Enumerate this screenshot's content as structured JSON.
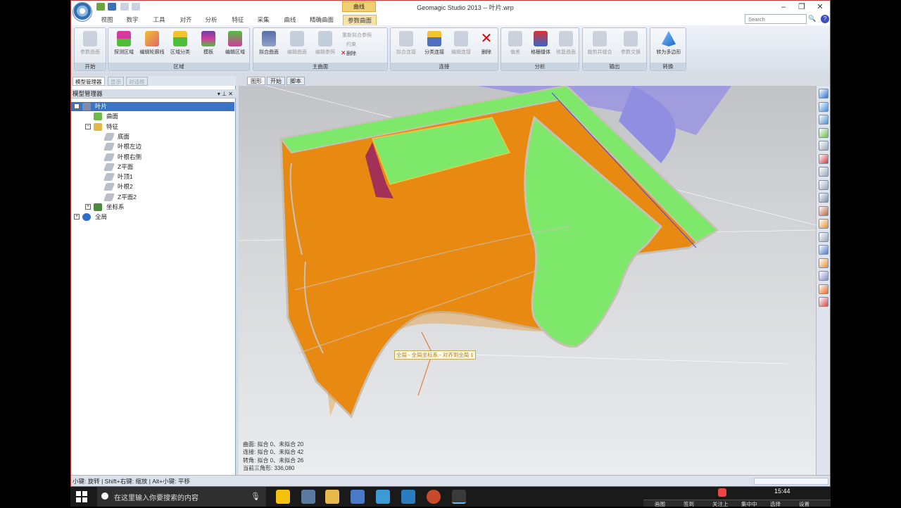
{
  "window": {
    "title": "Geomagic Studio 2013 -- 叶片.wrp",
    "context_tab": "曲线"
  },
  "menu_tabs": [
    "视图",
    "数字",
    "工具",
    "对齐",
    "分析",
    "特征",
    "采集",
    "曲线",
    "精确曲面",
    "参数曲面"
  ],
  "active_tab": "参数曲面",
  "search_placeholder": "Search",
  "ribbon": {
    "groups": [
      {
        "name": "开始",
        "buttons": [
          "参数曲面"
        ]
      },
      {
        "name": "区域",
        "buttons": [
          "探测区域",
          "编辑轮廓线",
          "区域分类",
          "模板",
          "编辑区域"
        ]
      },
      {
        "name": "主曲面",
        "buttons": [
          "拟合曲面",
          "编辑曲面",
          "编辑参照"
        ],
        "small": [
          "重新拟合参照",
          "约束",
          "删除"
        ]
      },
      {
        "name": "连接",
        "buttons": [
          "拟合连接",
          "分类连接",
          "编辑连接",
          "删除"
        ]
      },
      {
        "name": "分析",
        "buttons": [
          "偏差",
          "格栅缝体",
          "修复曲面"
        ]
      },
      {
        "name": "输出",
        "buttons": [
          "裁剪并缝合",
          "参数交换"
        ]
      },
      {
        "name": "转换",
        "buttons": [
          "转为多边形"
        ]
      }
    ]
  },
  "panel": {
    "tabs": [
      "模型管理器",
      "显示",
      "对话框"
    ],
    "title": "模型管理器",
    "pin": "▾ ⊥ ✕",
    "tree": [
      {
        "label": "叶片",
        "level": 0,
        "exp": "−",
        "selected": true,
        "icon": "part-icon"
      },
      {
        "label": "曲面",
        "level": 1,
        "exp": "",
        "icon": "surface-icon"
      },
      {
        "label": "特征",
        "level": 1,
        "exp": "−",
        "icon": "feature-icon"
      },
      {
        "label": "底面",
        "level": 2,
        "exp": "",
        "icon": "plane-icon"
      },
      {
        "label": "叶根左边",
        "level": 2,
        "exp": "",
        "icon": "plane-icon"
      },
      {
        "label": "叶根右侧",
        "level": 2,
        "exp": "",
        "icon": "plane-icon"
      },
      {
        "label": "Z平面",
        "level": 2,
        "exp": "",
        "icon": "plane-icon"
      },
      {
        "label": "叶顶1",
        "level": 2,
        "exp": "",
        "icon": "plane-icon"
      },
      {
        "label": "叶根2",
        "level": 2,
        "exp": "",
        "icon": "plane-icon"
      },
      {
        "label": "Z平面2",
        "level": 2,
        "exp": "",
        "icon": "plane-icon"
      },
      {
        "label": "坐标系",
        "level": 1,
        "exp": "+",
        "icon": "axis-icon"
      },
      {
        "label": "全局",
        "level": 0,
        "exp": "+",
        "icon": "globe-icon"
      }
    ]
  },
  "view_tabs": [
    "图形",
    "开始",
    "脚本"
  ],
  "viewport": {
    "label": "全局 - 全局坐标系 - 对齐到全局 1",
    "stats": [
      "曲面: 拟合 0、未拟合 20",
      "连接: 拟合 0、未拟合 42",
      "转角: 拟合 0、未拟合 26",
      "当前三角形: 336,080"
    ]
  },
  "status_text": "小键: 旋转 | Shift+右键: 缩放 | Alt+小键: 平移",
  "taskbar": {
    "search_text": "在这里输入你要搜索的内容",
    "time": "15:44",
    "tray": [
      "画图",
      "签到",
      "关注上",
      "集中中",
      "选择",
      "设置"
    ]
  },
  "colors": {
    "orange": "#e88a12",
    "green": "#7ee86a",
    "highlight": "#f7e3aa"
  }
}
